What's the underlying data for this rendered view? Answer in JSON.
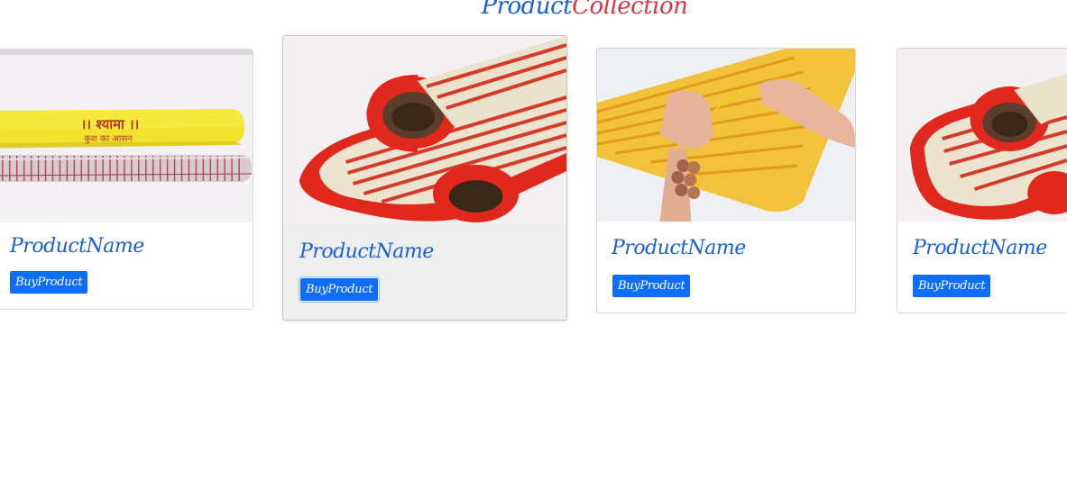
{
  "heading": {
    "part1": "Product",
    "part2": "Collection"
  },
  "cards": [
    {
      "name": "ProductName",
      "button": "BuyProduct",
      "image": "yellow-packaged-mat-photo"
    },
    {
      "name": "ProductName",
      "button": "BuyProduct",
      "image": "red-rolled-mat-photo"
    },
    {
      "name": "ProductName",
      "button": "BuyProduct",
      "image": "hands-tying-mat-photo"
    },
    {
      "name": "ProductName",
      "button": "BuyProduct",
      "image": "red-rolled-mat-photo"
    }
  ],
  "package_text": {
    "line1": "।। श्यामा ।।",
    "line2": "कुश का आसन"
  },
  "colors": {
    "accent": "#0d6efd",
    "title_blue": "#1a5fd6",
    "title_red": "#d9363e"
  }
}
